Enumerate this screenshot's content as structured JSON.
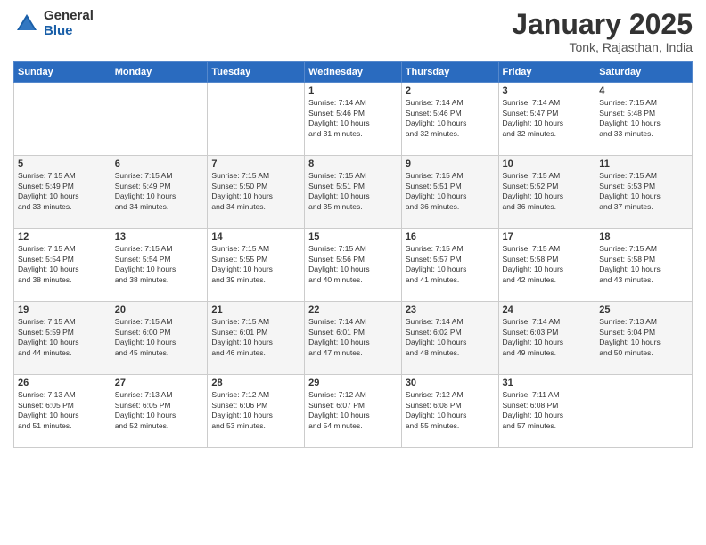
{
  "logo": {
    "general": "General",
    "blue": "Blue"
  },
  "title": "January 2025",
  "location": "Tonk, Rajasthan, India",
  "days_of_week": [
    "Sunday",
    "Monday",
    "Tuesday",
    "Wednesday",
    "Thursday",
    "Friday",
    "Saturday"
  ],
  "weeks": [
    [
      {
        "day": "",
        "info": ""
      },
      {
        "day": "",
        "info": ""
      },
      {
        "day": "",
        "info": ""
      },
      {
        "day": "1",
        "info": "Sunrise: 7:14 AM\nSunset: 5:46 PM\nDaylight: 10 hours\nand 31 minutes."
      },
      {
        "day": "2",
        "info": "Sunrise: 7:14 AM\nSunset: 5:46 PM\nDaylight: 10 hours\nand 32 minutes."
      },
      {
        "day": "3",
        "info": "Sunrise: 7:14 AM\nSunset: 5:47 PM\nDaylight: 10 hours\nand 32 minutes."
      },
      {
        "day": "4",
        "info": "Sunrise: 7:15 AM\nSunset: 5:48 PM\nDaylight: 10 hours\nand 33 minutes."
      }
    ],
    [
      {
        "day": "5",
        "info": "Sunrise: 7:15 AM\nSunset: 5:49 PM\nDaylight: 10 hours\nand 33 minutes."
      },
      {
        "day": "6",
        "info": "Sunrise: 7:15 AM\nSunset: 5:49 PM\nDaylight: 10 hours\nand 34 minutes."
      },
      {
        "day": "7",
        "info": "Sunrise: 7:15 AM\nSunset: 5:50 PM\nDaylight: 10 hours\nand 34 minutes."
      },
      {
        "day": "8",
        "info": "Sunrise: 7:15 AM\nSunset: 5:51 PM\nDaylight: 10 hours\nand 35 minutes."
      },
      {
        "day": "9",
        "info": "Sunrise: 7:15 AM\nSunset: 5:51 PM\nDaylight: 10 hours\nand 36 minutes."
      },
      {
        "day": "10",
        "info": "Sunrise: 7:15 AM\nSunset: 5:52 PM\nDaylight: 10 hours\nand 36 minutes."
      },
      {
        "day": "11",
        "info": "Sunrise: 7:15 AM\nSunset: 5:53 PM\nDaylight: 10 hours\nand 37 minutes."
      }
    ],
    [
      {
        "day": "12",
        "info": "Sunrise: 7:15 AM\nSunset: 5:54 PM\nDaylight: 10 hours\nand 38 minutes."
      },
      {
        "day": "13",
        "info": "Sunrise: 7:15 AM\nSunset: 5:54 PM\nDaylight: 10 hours\nand 38 minutes."
      },
      {
        "day": "14",
        "info": "Sunrise: 7:15 AM\nSunset: 5:55 PM\nDaylight: 10 hours\nand 39 minutes."
      },
      {
        "day": "15",
        "info": "Sunrise: 7:15 AM\nSunset: 5:56 PM\nDaylight: 10 hours\nand 40 minutes."
      },
      {
        "day": "16",
        "info": "Sunrise: 7:15 AM\nSunset: 5:57 PM\nDaylight: 10 hours\nand 41 minutes."
      },
      {
        "day": "17",
        "info": "Sunrise: 7:15 AM\nSunset: 5:58 PM\nDaylight: 10 hours\nand 42 minutes."
      },
      {
        "day": "18",
        "info": "Sunrise: 7:15 AM\nSunset: 5:58 PM\nDaylight: 10 hours\nand 43 minutes."
      }
    ],
    [
      {
        "day": "19",
        "info": "Sunrise: 7:15 AM\nSunset: 5:59 PM\nDaylight: 10 hours\nand 44 minutes."
      },
      {
        "day": "20",
        "info": "Sunrise: 7:15 AM\nSunset: 6:00 PM\nDaylight: 10 hours\nand 45 minutes."
      },
      {
        "day": "21",
        "info": "Sunrise: 7:15 AM\nSunset: 6:01 PM\nDaylight: 10 hours\nand 46 minutes."
      },
      {
        "day": "22",
        "info": "Sunrise: 7:14 AM\nSunset: 6:01 PM\nDaylight: 10 hours\nand 47 minutes."
      },
      {
        "day": "23",
        "info": "Sunrise: 7:14 AM\nSunset: 6:02 PM\nDaylight: 10 hours\nand 48 minutes."
      },
      {
        "day": "24",
        "info": "Sunrise: 7:14 AM\nSunset: 6:03 PM\nDaylight: 10 hours\nand 49 minutes."
      },
      {
        "day": "25",
        "info": "Sunrise: 7:13 AM\nSunset: 6:04 PM\nDaylight: 10 hours\nand 50 minutes."
      }
    ],
    [
      {
        "day": "26",
        "info": "Sunrise: 7:13 AM\nSunset: 6:05 PM\nDaylight: 10 hours\nand 51 minutes."
      },
      {
        "day": "27",
        "info": "Sunrise: 7:13 AM\nSunset: 6:05 PM\nDaylight: 10 hours\nand 52 minutes."
      },
      {
        "day": "28",
        "info": "Sunrise: 7:12 AM\nSunset: 6:06 PM\nDaylight: 10 hours\nand 53 minutes."
      },
      {
        "day": "29",
        "info": "Sunrise: 7:12 AM\nSunset: 6:07 PM\nDaylight: 10 hours\nand 54 minutes."
      },
      {
        "day": "30",
        "info": "Sunrise: 7:12 AM\nSunset: 6:08 PM\nDaylight: 10 hours\nand 55 minutes."
      },
      {
        "day": "31",
        "info": "Sunrise: 7:11 AM\nSunset: 6:08 PM\nDaylight: 10 hours\nand 57 minutes."
      },
      {
        "day": "",
        "info": ""
      }
    ]
  ]
}
